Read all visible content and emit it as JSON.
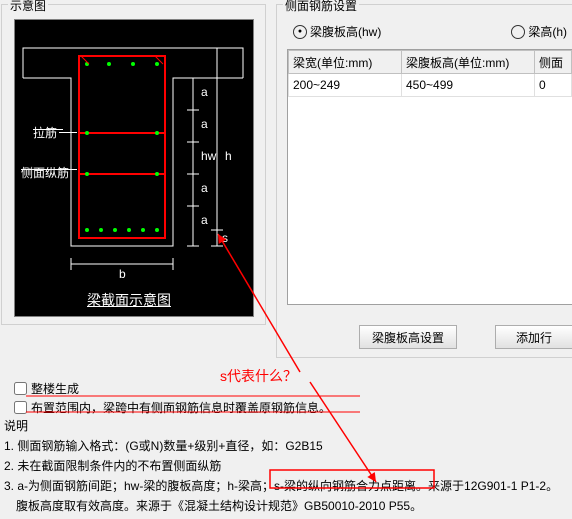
{
  "groups": {
    "diagram_title": "示意图",
    "side_rebar_title": "侧面钢筋设置"
  },
  "diagram": {
    "label_tie": "拉筋",
    "label_side": "侧面纵筋",
    "caption": "梁截面示意图",
    "sym_hw": "hw",
    "sym_h": "h",
    "sym_b": "b",
    "sym_a": "a",
    "sym_s": "s"
  },
  "radio": {
    "opt1": "梁腹板高(hw)",
    "opt2": "梁高(h)"
  },
  "table": {
    "headers": [
      "梁宽(单位:mm)",
      "梁腹板高(单位:mm)",
      "侧面"
    ],
    "rows": [
      [
        "200~249",
        "450~499",
        "0"
      ]
    ]
  },
  "buttons": {
    "set_hw": "梁腹板高设置",
    "add_row": "添加行"
  },
  "checks": {
    "whole": "整楼生成",
    "range": "布置范围内，梁跨中有侧面钢筋信息时覆盖原钢筋信息。"
  },
  "notes_title": "说明",
  "notes": [
    "1. 侧面钢筋输入格式：(G或N)数量+级别+直径，如：G2B15",
    "2. 未在截面限制条件内的不布置侧面纵筋",
    "3. a-为侧面钢筋间距；hw-梁的腹板高度；h-梁高；s-梁的纵向钢筋合力点距离。来源于12G901-1 P1-2。",
    "　腹板高度取有效高度。来源于《混凝土结构设计规范》GB50010-2010 P55。"
  ],
  "annotation": {
    "question": "s代表什么？"
  },
  "icons": {
    "radio_dot": "●"
  }
}
